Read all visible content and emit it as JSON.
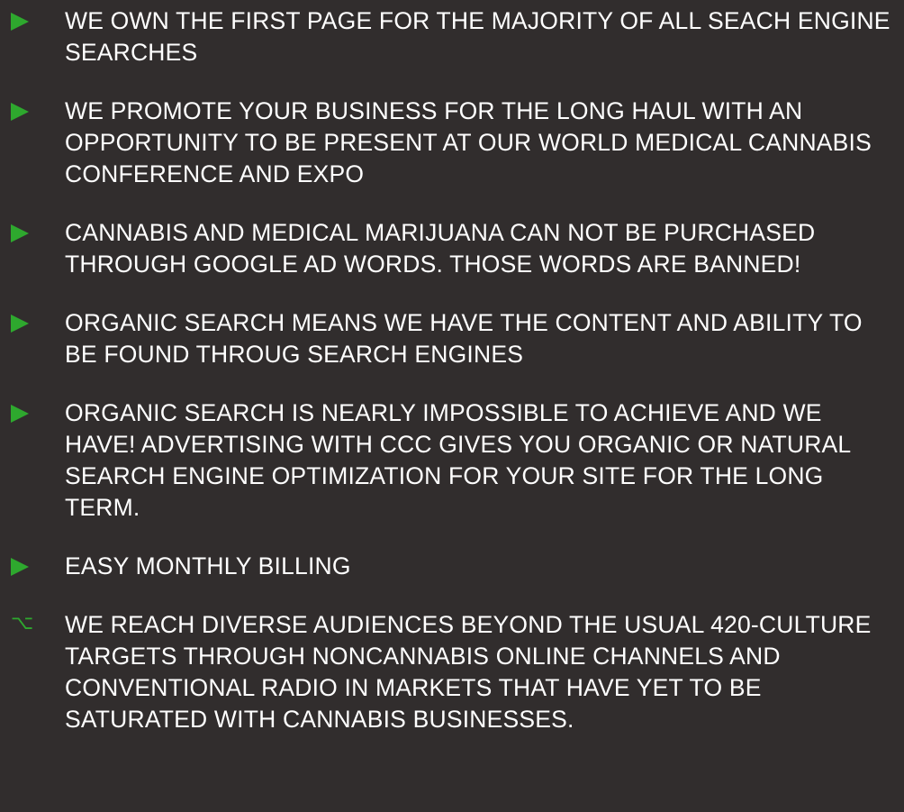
{
  "bullets": [
    {
      "icon": "triangle-bullet-icon",
      "text": "WE OWN THE FIRST PAGE FOR THE MAJORITY OF ALL SEACH ENGINE SEARCHES"
    },
    {
      "icon": "triangle-bullet-icon",
      "text": "WE PROMOTE YOUR BUSINESS FOR THE LONG HAUL WITH AN OPPORTUNITY TO BE PRESENT AT OUR WORLD MEDICAL CANNABIS CONFERENCE AND EXPO"
    },
    {
      "icon": "triangle-bullet-icon",
      "text": "CANNABIS AND MEDICAL MARIJUANA CAN NOT BE PURCHASED THROUGH GOOGLE AD WORDS.  THOSE WORDS ARE BANNED!"
    },
    {
      "icon": "triangle-bullet-icon",
      "text": "ORGANIC SEARCH MEANS WE HAVE THE CONTENT AND ABILITY TO BE FOUND THROUG SEARCH ENGINES"
    },
    {
      "icon": "triangle-bullet-icon",
      "text": "ORGANIC SEARCH IS NEARLY IMPOSSIBLE TO ACHIEVE AND WE HAVE! ADVERTISING WITH CCC GIVES YOU ORGANIC OR NATURAL SEARCH ENGINE OPTIMIZATION FOR YOUR SITE FOR THE LONG TERM."
    },
    {
      "icon": "triangle-bullet-icon",
      "text": "EASY MONTHLY BILLING"
    },
    {
      "icon": "option-key-bullet-icon",
      "glyph": "⌥",
      "text": "WE REACH DIVERSE AUDIENCES BEYOND THE USUAL 420-CULTURE TARGETS THROUGH NONCANNABIS ONLINE CHANNELS AND CONVENTIONAL RADIO IN MARKETS THAT HAVE YET TO BE SATURATED WITH CANNABIS BUSINESSES."
    }
  ],
  "colors": {
    "background": "#312d2d",
    "text": "#ffffff",
    "accent": "#2ea82e"
  }
}
